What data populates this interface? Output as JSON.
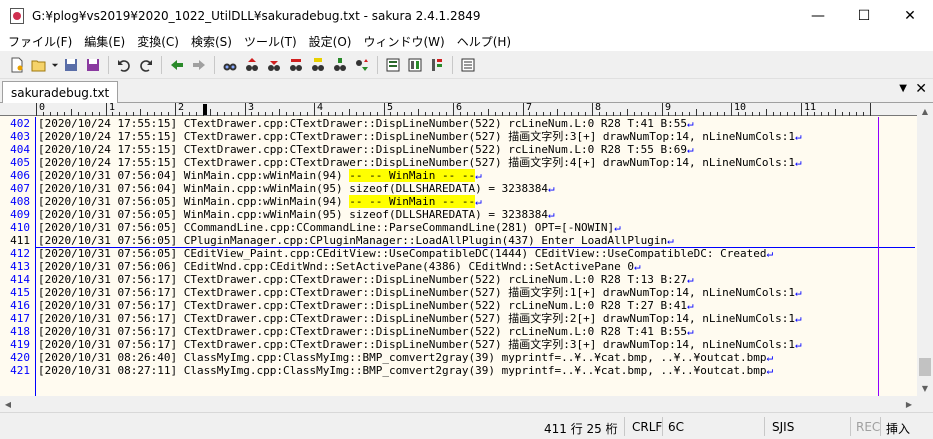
{
  "window": {
    "title": "G:¥plog¥vs2019¥2020_1022_UtilDLL¥sakuradebug.txt - sakura 2.4.1.2849",
    "minimize": "—",
    "maximize": "☐",
    "close": "✕"
  },
  "menu": [
    "ファイル(F)",
    "編集(E)",
    "変換(C)",
    "検索(S)",
    "ツール(T)",
    "設定(O)",
    "ウィンドウ(W)",
    "ヘルプ(H)"
  ],
  "tab": {
    "label": "sakuradebug.txt",
    "menu": "▼",
    "close": "✕"
  },
  "ruler": {
    "labels": [
      "0",
      "1",
      "2",
      "3",
      "4",
      "5",
      "6",
      "7",
      "8",
      "9",
      "10",
      "11"
    ]
  },
  "editor": {
    "eol_mark": "↵",
    "lines": [
      {
        "n": "402",
        "t": "[2020/10/24 17:55:15] CTextDrawer.cpp:CTextDrawer::DispLineNumber(522) rcLineNum.L:0 R28 T:41 B:55"
      },
      {
        "n": "403",
        "t": "[2020/10/24 17:55:15] CTextDrawer.cpp:CTextDrawer::DispLineNumber(527) 描画文字列:3[+] drawNumTop:14, nLineNumCols:1"
      },
      {
        "n": "404",
        "t": "[2020/10/24 17:55:15] CTextDrawer.cpp:CTextDrawer::DispLineNumber(522) rcLineNum.L:0 R28 T:55 B:69"
      },
      {
        "n": "405",
        "t": "[2020/10/24 17:55:15] CTextDrawer.cpp:CTextDrawer::DispLineNumber(527) 描画文字列:4[+] drawNumTop:14, nLineNumCols:1"
      },
      {
        "n": "406",
        "t": "[2020/10/31 07:56:04] WinMain.cpp:wWinMain(94) ",
        "h": "-- -- WinMain -- --"
      },
      {
        "n": "407",
        "t": "[2020/10/31 07:56:04] WinMain.cpp:wWinMain(95) sizeof(DLLSHAREDATA) = 3238384"
      },
      {
        "n": "408",
        "t": "[2020/10/31 07:56:05] WinMain.cpp:wWinMain(94) ",
        "h": "-- -- WinMain -- --"
      },
      {
        "n": "409",
        "t": "[2020/10/31 07:56:05] WinMain.cpp:wWinMain(95) sizeof(DLLSHAREDATA) = 3238384"
      },
      {
        "n": "410",
        "t": "[2020/10/31 07:56:05] CCommandLine.cpp:CCommandLine::ParseCommandLine(281) OPT=[-NOWIN]"
      },
      {
        "n": "411",
        "t": "[2020/10/31 07:56:05] CPluginManager.cpp:CPluginManager::LoadAllPlugin(437) Enter LoadAllPlugin"
      },
      {
        "n": "412",
        "t": "[2020/10/31 07:56:05] CEditView_Paint.cpp:CEditView::UseCompatibleDC(1444) CEditView::UseCompatibleDC: Created"
      },
      {
        "n": "413",
        "t": "[2020/10/31 07:56:06] CEditWnd.cpp:CEditWnd::SetActivePane(4386) CEditWnd::SetActivePane 0"
      },
      {
        "n": "414",
        "t": "[2020/10/31 07:56:17] CTextDrawer.cpp:CTextDrawer::DispLineNumber(522) rcLineNum.L:0 R28 T:13 B:27"
      },
      {
        "n": "415",
        "t": "[2020/10/31 07:56:17] CTextDrawer.cpp:CTextDrawer::DispLineNumber(527) 描画文字列:1[+] drawNumTop:14, nLineNumCols:1"
      },
      {
        "n": "416",
        "t": "[2020/10/31 07:56:17] CTextDrawer.cpp:CTextDrawer::DispLineNumber(522) rcLineNum.L:0 R28 T:27 B:41"
      },
      {
        "n": "417",
        "t": "[2020/10/31 07:56:17] CTextDrawer.cpp:CTextDrawer::DispLineNumber(527) 描画文字列:2[+] drawNumTop:14, nLineNumCols:1"
      },
      {
        "n": "418",
        "t": "[2020/10/31 07:56:17] CTextDrawer.cpp:CTextDrawer::DispLineNumber(522) rcLineNum.L:0 R28 T:41 B:55"
      },
      {
        "n": "419",
        "t": "[2020/10/31 07:56:17] CTextDrawer.cpp:CTextDrawer::DispLineNumber(527) 描画文字列:3[+] drawNumTop:14, nLineNumCols:1"
      },
      {
        "n": "420",
        "t": "[2020/10/31 08:26:40] ClassMyImg.cpp:ClassMyImg::BMP_comvert2gray(39) myprintf=..¥..¥cat.bmp, ..¥..¥outcat.bmp"
      },
      {
        "n": "421",
        "t": "[2020/10/31 08:27:11] ClassMyImg.cpp:ClassMyImg::BMP_comvert2gray(39) myprintf=..¥..¥cat.bmp, ..¥..¥outcat.bmp"
      }
    ]
  },
  "status": {
    "position": "411 行  25 桁",
    "eol": "CRLF",
    "charcode": "6C",
    "encoding": "SJIS",
    "rec": "REC",
    "insert": "挿入"
  },
  "colors": {
    "editor_bg": "#fffbf0",
    "line_number": "#0000ff",
    "highlight": "#ffff00",
    "wrap_line": "#9000ff"
  }
}
